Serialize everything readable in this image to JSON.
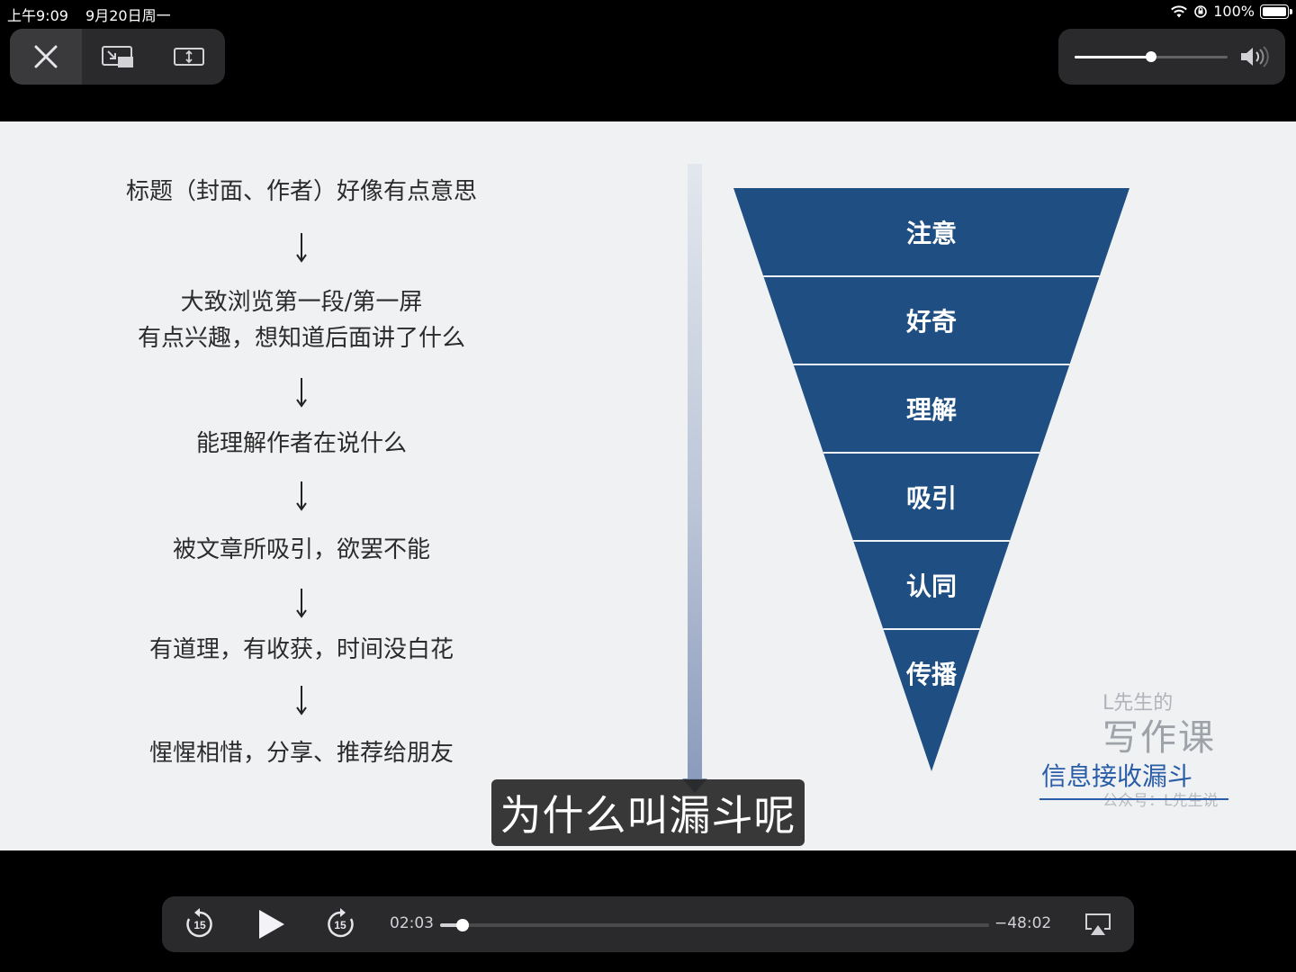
{
  "status_bar": {
    "time": "上午9:09",
    "date": "9月20日周一",
    "battery": "100%"
  },
  "top_controls": {
    "close_icon": "close-icon",
    "pip_icon": "picture-in-picture-icon",
    "aspect_icon": "aspect-fit-icon"
  },
  "volume": {
    "level": 0.5,
    "icon": "speaker-icon"
  },
  "slide": {
    "flow_steps": [
      "标题（封面、作者）好像有点意思",
      "大致浏览第一段/第一屏",
      "有点兴趣，想知道后面讲了什么",
      "能理解作者在说什么",
      "被文章所吸引，欲罢不能",
      "有道理，有收获，时间没白花",
      "惺惺相惜，分享、推荐给朋友"
    ],
    "funnel_levels": [
      "注意",
      "好奇",
      "理解",
      "吸引",
      "认同",
      "传播"
    ],
    "funnel_color": "#1f4e82",
    "watermark": {
      "line1": "L先生的",
      "line2": "写作课",
      "caption": "信息接收漏斗",
      "sub": "公众号：L先生说"
    }
  },
  "subtitle": "为什么叫漏斗呢",
  "playback": {
    "elapsed": "02:03",
    "remaining": "−48:02",
    "progress": 0.0405,
    "skip_back_seconds": "15",
    "skip_forward_seconds": "15"
  }
}
